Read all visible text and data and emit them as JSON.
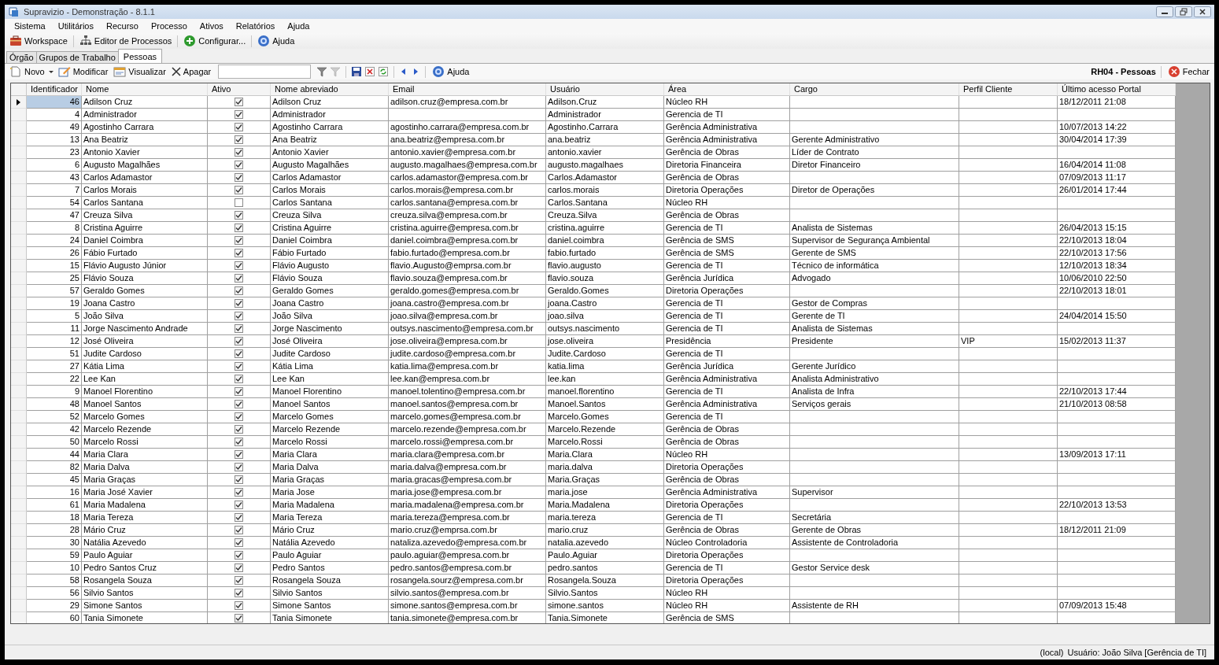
{
  "window": {
    "title": "Supravizio - Demonstração - 8.1.1"
  },
  "menu": [
    "Sistema",
    "Utilitários",
    "Recurso",
    "Processo",
    "Ativos",
    "Relatórios",
    "Ajuda"
  ],
  "main_toolbar": [
    {
      "label": "Workspace",
      "kind": "briefcase"
    },
    {
      "label": "Editor de Processos",
      "kind": "hierarchy"
    },
    {
      "label": "Configurar...",
      "kind": "plus"
    },
    {
      "label": "Ajuda",
      "kind": "help"
    }
  ],
  "tabs": [
    {
      "label": "Órgão",
      "selected": false
    },
    {
      "label": "Grupos de Trabalho",
      "selected": false
    },
    {
      "label": "Pessoas",
      "selected": true
    }
  ],
  "toolbar": {
    "new": "Novo",
    "modify": "Modificar",
    "view": "Visualizar",
    "delete": "Apagar",
    "help": "Ajuda",
    "screen_title": "RH04 - Pessoas",
    "close": "Fechar"
  },
  "table": {
    "columns": [
      "Identificador",
      "Nome",
      "Ativo",
      "Nome abreviado",
      "Email",
      "Usuário",
      "Área",
      "Cargo",
      "Perfil Cliente",
      "Último acesso Portal"
    ],
    "rows": [
      {
        "selected": true,
        "id": "46",
        "name": "Adilson Cruz",
        "active": true,
        "short_name": "Adilson Cruz",
        "email": "adilson.cruz@empresa.com.br",
        "user": "Adilson.Cruz",
        "area": "Núcleo RH",
        "last_access": "18/12/2011 21:08"
      },
      {
        "selected": false,
        "id": "4",
        "name": "Administrador",
        "active": true,
        "short_name": "Administrador",
        "user": "Administrador",
        "area": "Gerencia de TI"
      },
      {
        "selected": false,
        "id": "49",
        "name": "Agostinho Carrara",
        "active": true,
        "short_name": "Agostinho Carrara",
        "email": "agostinho.carrara@empresa.com.br",
        "user": "Agostinho.Carrara",
        "area": "Gerência Administrativa",
        "last_access": "10/07/2013 14:22"
      },
      {
        "selected": false,
        "id": "13",
        "name": "Ana Beatriz",
        "active": true,
        "short_name": "Ana Beatriz",
        "email": "ana.beatriz@empresa.com.br",
        "user": "ana.beatriz",
        "area": "Gerência Administrativa",
        "role": "Gerente Administrativo",
        "last_access": "30/04/2014 17:39"
      },
      {
        "selected": false,
        "id": "23",
        "name": "Antonio Xavier",
        "active": true,
        "short_name": "Antonio Xavier",
        "email": "antonio.xavier@empresa.com.br",
        "user": "antonio.xavier",
        "area": "Gerência de Obras",
        "role": "Líder de Contrato"
      },
      {
        "selected": false,
        "id": "6",
        "name": "Augusto Magalhães",
        "active": true,
        "short_name": "Augusto Magalhães",
        "email": "augusto.magalhaes@empresa.com.br",
        "user": "augusto.magalhaes",
        "area": "Diretoria Financeira",
        "role": "Diretor Financeiro",
        "last_access": "16/04/2014 11:08"
      },
      {
        "selected": false,
        "id": "43",
        "name": "Carlos Adamastor",
        "active": true,
        "short_name": "Carlos Adamastor",
        "email": "carlos.adamastor@empresa.com.br",
        "user": "Carlos.Adamastor",
        "area": "Gerência de Obras",
        "last_access": "07/09/2013 11:17"
      },
      {
        "selected": false,
        "id": "7",
        "name": "Carlos Morais",
        "active": true,
        "short_name": "Carlos Morais",
        "email": "carlos.morais@empresa.com.br",
        "user": "carlos.morais",
        "area": "Diretoria Operações",
        "role": "Diretor de Operações",
        "last_access": "26/01/2014 17:44"
      },
      {
        "selected": false,
        "id": "54",
        "name": "Carlos Santana",
        "active": false,
        "short_name": "Carlos Santana",
        "email": "carlos.santana@empresa.com.br",
        "user": "Carlos.Santana",
        "area": "Núcleo RH"
      },
      {
        "selected": false,
        "id": "47",
        "name": "Creuza Silva",
        "active": true,
        "short_name": "Creuza Silva",
        "email": "creuza.silva@empresa.com.br",
        "user": "Creuza.Silva",
        "area": "Gerência de Obras"
      },
      {
        "selected": false,
        "id": "8",
        "name": "Cristina Aguirre",
        "active": true,
        "short_name": "Cristina Aguirre",
        "email": "cristina.aguirre@empresa.com.br",
        "user": "cristina.aguirre",
        "area": "Gerencia de TI",
        "role": "Analista de Sistemas",
        "last_access": "26/04/2013 15:15"
      },
      {
        "selected": false,
        "id": "24",
        "name": "Daniel Coimbra",
        "active": true,
        "short_name": "Daniel Coimbra",
        "email": "daniel.coimbra@empresa.com.br",
        "user": "daniel.coimbra",
        "area": "Gerência de SMS",
        "role": "Supervisor de Segurança Ambiental",
        "last_access": "22/10/2013 18:04"
      },
      {
        "selected": false,
        "id": "26",
        "name": "Fábio Furtado",
        "active": true,
        "short_name": "Fábio Furtado",
        "email": "fabio.furtado@empresa.com.br",
        "user": "fabio.furtado",
        "area": "Gerência de SMS",
        "role": "Gerente de SMS",
        "last_access": "22/10/2013 17:56"
      },
      {
        "selected": false,
        "id": "15",
        "name": "Flávio Augusto Júnior",
        "active": true,
        "short_name": "Flávio Augusto",
        "email": "flavio.Augusto@emprsa.com.br",
        "user": "flavio.augusto",
        "area": "Gerencia de TI",
        "role": "Técnico de informática",
        "last_access": "12/10/2013 18:34"
      },
      {
        "selected": false,
        "id": "25",
        "name": "Flávio Souza",
        "active": true,
        "short_name": "Flávio Souza",
        "email": "flavio.souza@empresa.com.br",
        "user": "flavio.souza",
        "area": "Gerência Jurídica",
        "role": "Advogado",
        "last_access": "10/06/2010 22:50"
      },
      {
        "selected": false,
        "id": "57",
        "name": "Geraldo Gomes",
        "active": true,
        "short_name": "Geraldo Gomes",
        "email": "geraldo.gomes@empresa.com.br",
        "user": "Geraldo.Gomes",
        "area": "Diretoria Operações",
        "last_access": "22/10/2013 18:01"
      },
      {
        "selected": false,
        "id": "19",
        "name": "Joana Castro",
        "active": true,
        "short_name": "Joana Castro",
        "email": "joana.castro@empresa.com.br",
        "user": "joana.Castro",
        "area": "Gerencia de TI",
        "role": "Gestor de Compras"
      },
      {
        "selected": false,
        "id": "5",
        "name": "João Silva",
        "active": true,
        "short_name": "João Silva",
        "email": "joao.silva@empresa.com.br",
        "user": "joao.silva",
        "area": "Gerencia de TI",
        "role": "Gerente de TI",
        "last_access": "24/04/2014 15:50"
      },
      {
        "selected": false,
        "id": "11",
        "name": "Jorge Nascimento Andrade",
        "active": true,
        "short_name": "Jorge Nascimento",
        "email": "outsys.nascimento@empresa.com.br",
        "user": "outsys.nascimento",
        "area": "Gerencia de TI",
        "role": "Analista de Sistemas"
      },
      {
        "selected": false,
        "id": "12",
        "name": "José Oliveira",
        "active": true,
        "short_name": "José Oliveira",
        "email": "jose.oliveira@empresa.com.br",
        "user": "jose.oliveira",
        "area": "Presidência",
        "role": "Presidente",
        "profile": "VIP",
        "last_access": "15/02/2013 11:37"
      },
      {
        "selected": false,
        "id": "51",
        "name": "Judite Cardoso",
        "active": true,
        "short_name": "Judite Cardoso",
        "email": "judite.cardoso@empresa.com.br",
        "user": "Judite.Cardoso",
        "area": "Gerencia de TI"
      },
      {
        "selected": false,
        "id": "27",
        "name": "Kátia Lima",
        "active": true,
        "short_name": "Kátia Lima",
        "email": "katia.lima@empresa.com.br",
        "user": "katia.lima",
        "area": "Gerência Jurídica",
        "role": "Gerente Jurídico"
      },
      {
        "selected": false,
        "id": "22",
        "name": "Lee Kan",
        "active": true,
        "short_name": "Lee Kan",
        "email": "lee.kan@empresa.com.br",
        "user": "lee.kan",
        "area": "Gerência Administrativa",
        "role": "Analista Administrativo"
      },
      {
        "selected": false,
        "id": "9",
        "name": "Manoel Florentino",
        "active": true,
        "short_name": "Manoel Florentino",
        "email": "manoel.tolentino@empresa.com.br",
        "user": "manoel.florentino",
        "area": "Gerencia de TI",
        "role": "Analista de Infra",
        "last_access": "22/10/2013 17:44"
      },
      {
        "selected": false,
        "id": "48",
        "name": "Manoel Santos",
        "active": true,
        "short_name": "Manoel Santos",
        "email": "manoel.santos@empresa.com.br",
        "user": "Manoel.Santos",
        "area": "Gerência Administrativa",
        "role": "Serviços gerais",
        "last_access": "21/10/2013 08:58"
      },
      {
        "selected": false,
        "id": "52",
        "name": "Marcelo Gomes",
        "active": true,
        "short_name": "Marcelo Gomes",
        "email": "marcelo.gomes@empresa.com.br",
        "user": "Marcelo.Gomes",
        "area": "Gerencia de TI"
      },
      {
        "selected": false,
        "id": "42",
        "name": "Marcelo Rezende",
        "active": true,
        "short_name": "Marcelo Rezende",
        "email": "marcelo.rezende@empresa.com.br",
        "user": "Marcelo.Rezende",
        "area": "Gerência de Obras"
      },
      {
        "selected": false,
        "id": "50",
        "name": "Marcelo Rossi",
        "active": true,
        "short_name": "Marcelo Rossi",
        "email": "marcelo.rossi@empresa.com.br",
        "user": "Marcelo.Rossi",
        "area": "Gerência de Obras"
      },
      {
        "selected": false,
        "id": "44",
        "name": "Maria Clara",
        "active": true,
        "short_name": "Maria Clara",
        "email": "maria.clara@empresa.com.br",
        "user": "Maria.Clara",
        "area": "Núcleo RH",
        "last_access": "13/09/2013 17:11"
      },
      {
        "selected": false,
        "id": "82",
        "name": "Maria Dalva",
        "active": true,
        "short_name": "Maria Dalva",
        "email": "maria.dalva@empresa.com.br",
        "user": "maria.dalva",
        "area": "Diretoria Operações"
      },
      {
        "selected": false,
        "id": "45",
        "name": "Maria Graças",
        "active": true,
        "short_name": "Maria Graças",
        "email": "maria.gracas@empresa.com.br",
        "user": "Maria.Graças",
        "area": "Gerência de Obras"
      },
      {
        "selected": false,
        "id": "16",
        "name": "Maria José Xavier",
        "active": true,
        "short_name": "Maria Jose",
        "email": "maria.jose@empresa.com.br",
        "user": "maria.jose",
        "area": "Gerência Administrativa",
        "role": "Supervisor"
      },
      {
        "selected": false,
        "id": "61",
        "name": "Maria Madalena",
        "active": true,
        "short_name": "Maria Madalena",
        "email": "maria.madalena@empresa.com.br",
        "user": "Maria.Madalena",
        "area": "Diretoria Operações",
        "last_access": "22/10/2013 13:53"
      },
      {
        "selected": false,
        "id": "18",
        "name": "Maria Tereza",
        "active": true,
        "short_name": "Maria Tereza",
        "email": "maria.tereza@empresa.com.br",
        "user": "maria.tereza",
        "area": "Gerencia de TI",
        "role": "Secretária"
      },
      {
        "selected": false,
        "id": "28",
        "name": "Mário Cruz",
        "active": true,
        "short_name": "Mário Cruz",
        "email": "mario.cruz@emprsa.com.br",
        "user": "mario.cruz",
        "area": "Gerência de Obras",
        "role": "Gerente de Obras",
        "last_access": "18/12/2011 21:09"
      },
      {
        "selected": false,
        "id": "30",
        "name": "Natália Azevedo",
        "active": true,
        "short_name": "Natália Azevedo",
        "email": "nataliza.azevedo@empresa.com.br",
        "user": "natalia.azevedo",
        "area": "Núcleo Controladoria",
        "role": "Assistente de Controladoria"
      },
      {
        "selected": false,
        "id": "59",
        "name": "Paulo Aguiar",
        "active": true,
        "short_name": "Paulo Aguiar",
        "email": "paulo.aguiar@empresa.com.br",
        "user": "Paulo.Aguiar",
        "area": "Diretoria Operações"
      },
      {
        "selected": false,
        "id": "10",
        "name": "Pedro Santos Cruz",
        "active": true,
        "short_name": "Pedro Santos",
        "email": "pedro.santos@empresa.com.br",
        "user": "pedro.santos",
        "area": "Gerencia de TI",
        "role": "Gestor Service desk"
      },
      {
        "selected": false,
        "id": "58",
        "name": "Rosangela Souza",
        "active": true,
        "short_name": "Rosangela Souza",
        "email": "rosangela.sourz@empresa.com.br",
        "user": "Rosangela.Souza",
        "area": "Diretoria Operações"
      },
      {
        "selected": false,
        "id": "56",
        "name": "Silvio Santos",
        "active": true,
        "short_name": "Silvio Santos",
        "email": "silvio.santos@empresa.com.br",
        "user": "Silvio.Santos",
        "area": "Núcleo RH"
      },
      {
        "selected": false,
        "id": "29",
        "name": "Simone Santos",
        "active": true,
        "short_name": "Simone Santos",
        "email": "simone.santos@empresa.com.br",
        "user": "simone.santos",
        "area": "Núcleo RH",
        "role": "Assistente de RH",
        "last_access": "07/09/2013 15:48"
      },
      {
        "selected": false,
        "id": "60",
        "name": "Tania Simonete",
        "active": true,
        "short_name": "Tania Simonete",
        "email": "tania.simonete@empresa.com.br",
        "user": "Tania.Simonete",
        "area": "Gerência de SMS"
      }
    ]
  },
  "status_bar": {
    "connection": "(local)",
    "user": "Usuário: João Silva [Gerência de TI]"
  }
}
